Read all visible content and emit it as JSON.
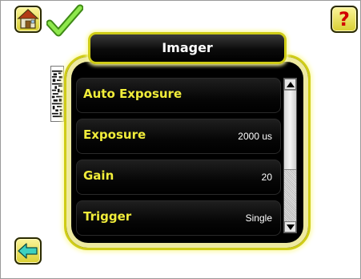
{
  "header": {
    "title": "Imager",
    "home_icon": "home-icon",
    "status_icon": "checkmark-icon",
    "help_icon": "question-mark-icon",
    "help_glyph": "?"
  },
  "colors": {
    "accent": "#d9cf32",
    "label_text": "#f1ed3a",
    "value_text": "#ffffff",
    "panel_bg": "#000000"
  },
  "menu": {
    "items": [
      {
        "label": "Auto Exposure",
        "value": ""
      },
      {
        "label": "Exposure",
        "value": "2000 us"
      },
      {
        "label": "Gain",
        "value": "20"
      },
      {
        "label": "Trigger",
        "value": "Single"
      }
    ]
  },
  "footer": {
    "back_icon": "back-arrow-icon"
  }
}
